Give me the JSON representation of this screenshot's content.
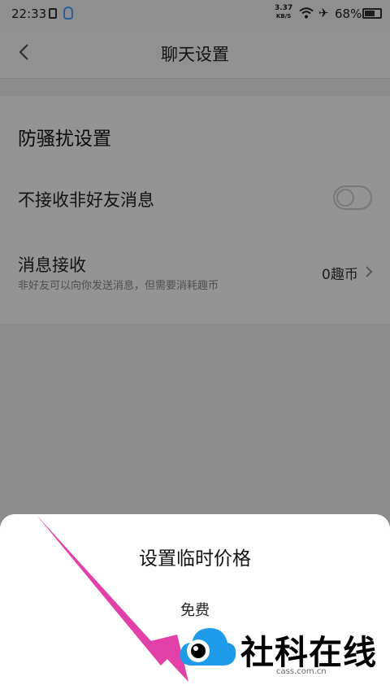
{
  "status_bar": {
    "time": "22:33",
    "net_speed_value": "3.37",
    "net_speed_unit": "KB/S",
    "battery_percent": "68%",
    "battery_level": 0.68
  },
  "header": {
    "title": "聊天设置"
  },
  "settings": {
    "section_title": "防骚扰设置",
    "reject_nonfriend_label": "不接收非好友消息",
    "reject_nonfriend_on": false,
    "message_receive_label": "消息接收",
    "message_receive_desc": "非好友可以向你发送消息，但需要消耗趣币",
    "message_receive_value": "0趣币"
  },
  "sheet": {
    "title": "设置临时价格",
    "option_free": "免费"
  },
  "watermark": {
    "text": "社科在线",
    "url": "cass.com.cn"
  },
  "colors": {
    "overlay": "rgba(0,0,0,0.42)",
    "annotation_arrow": "#e040a8",
    "watermark_blue": "#1e9be8"
  }
}
